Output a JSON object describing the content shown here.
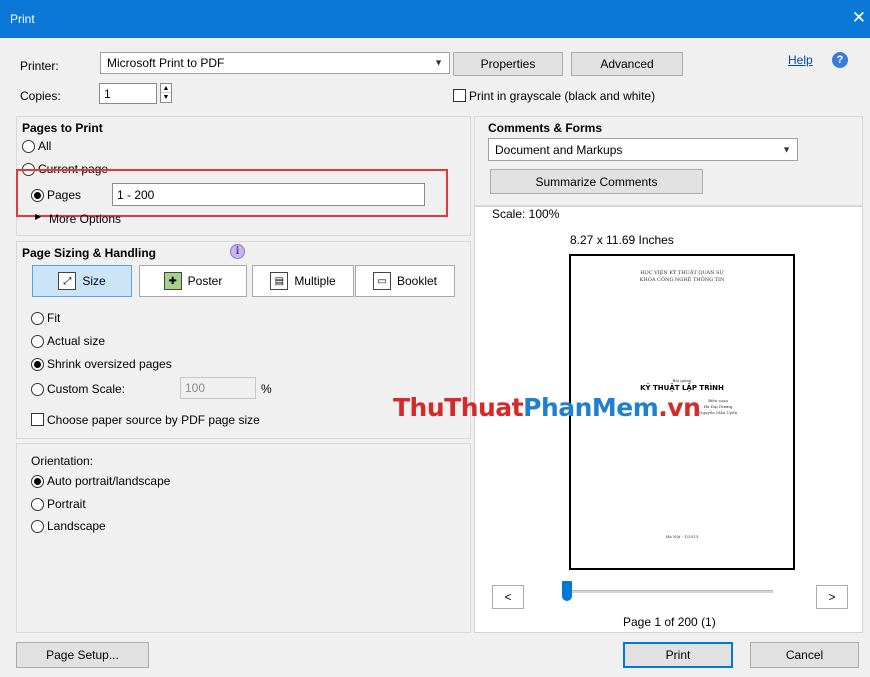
{
  "window": {
    "title": "Print",
    "close_glyph": "✕"
  },
  "printer": {
    "label": "Printer:",
    "selected": "Microsoft Print to PDF",
    "properties_label": "Properties",
    "advanced_label": "Advanced",
    "help_label": "Help",
    "copies_label": "Copies:",
    "copies_value": "1",
    "grayscale_label": "Print in grayscale (black and white)",
    "grayscale_checked": false
  },
  "pages_to_print": {
    "heading": "Pages to Print",
    "all_label": "All",
    "current_label": "Current page",
    "pages_label": "Pages",
    "pages_value": "1 - 200",
    "selected": "pages",
    "more_options_label": "More Options"
  },
  "comments_forms": {
    "heading": "Comments & Forms",
    "selected": "Document and Markups",
    "summarize_label": "Summarize Comments"
  },
  "page_sizing": {
    "heading": "Page Sizing & Handling",
    "tabs": [
      {
        "label": "Size",
        "icon": "size-icon",
        "active": true
      },
      {
        "label": "Poster",
        "icon": "poster-icon",
        "active": false
      },
      {
        "label": "Multiple",
        "icon": "multiple-icon",
        "active": false
      },
      {
        "label": "Booklet",
        "icon": "booklet-icon",
        "active": false
      }
    ],
    "fit_label": "Fit",
    "actual_label": "Actual size",
    "shrink_label": "Shrink oversized pages",
    "custom_label": "Custom Scale:",
    "custom_value": "100",
    "percent_label": "%",
    "selected": "shrink",
    "paper_source_label": "Choose paper source by PDF page size",
    "paper_source_checked": false
  },
  "orientation": {
    "heading": "Orientation:",
    "auto_label": "Auto portrait/landscape",
    "portrait_label": "Portrait",
    "landscape_label": "Landscape",
    "selected": "auto"
  },
  "preview": {
    "scale_label": "Scale: 100%",
    "page_size_label": "8.27 x 11.69 Inches",
    "sheet": {
      "header_line1": "HỌC VIỆN KỸ THUẬT QUÂN SỰ",
      "header_line2": "KHOA CÔNG NGHỆ THÔNG TIN",
      "small_title": "Bài giảng",
      "main_title": "KỸ THUẬT LẬP TRÌNH",
      "author_label": "Biên soạn",
      "author1": "Hà Đại Dương",
      "author2": "Nguyễn Mậu Uyên",
      "footer": "Hà Nội - 1/2013"
    },
    "prev_glyph": "<",
    "next_glyph": ">",
    "page_indicator": "Page 1 of 200 (1)",
    "slider_position": 0.005
  },
  "watermark": {
    "part1": "ThuThuat",
    "part2": "PhanMem",
    "part3": ".vn"
  },
  "footer": {
    "page_setup_label": "Page Setup...",
    "print_label": "Print",
    "cancel_label": "Cancel"
  },
  "colors": {
    "title_bar": "#0b78d7",
    "highlight_box": "#e03a3a",
    "watermark_red": "#d62a2a",
    "watermark_blue": "#1f7fd1",
    "slider_thumb": "#0078d7"
  }
}
